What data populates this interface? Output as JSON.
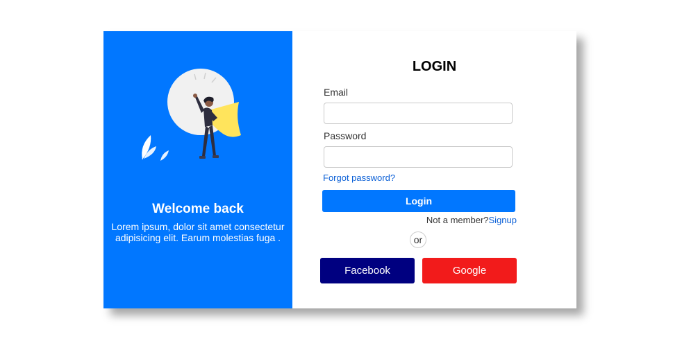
{
  "colors": {
    "primary": "#0177ff",
    "facebook": "#000080",
    "google": "#f21b1b",
    "link": "#0a5fd6"
  },
  "left_panel": {
    "illustration_icon": "superhero-illustration",
    "welcome_title": "Welcome back",
    "welcome_text": "Lorem ipsum, dolor sit amet consectetur adipisicing elit. Earum molestias fuga ."
  },
  "login_form": {
    "title": "LOGIN",
    "email_label": "Email",
    "email_value": "",
    "email_placeholder": "",
    "password_label": "Password",
    "password_value": "",
    "password_placeholder": "",
    "forgot_link": "Forgot password?",
    "login_button": "Login",
    "not_member_text": "Not a member?",
    "signup_link": "Signup",
    "or_text": "or",
    "facebook_button": "Facebook",
    "google_button": "Google"
  }
}
